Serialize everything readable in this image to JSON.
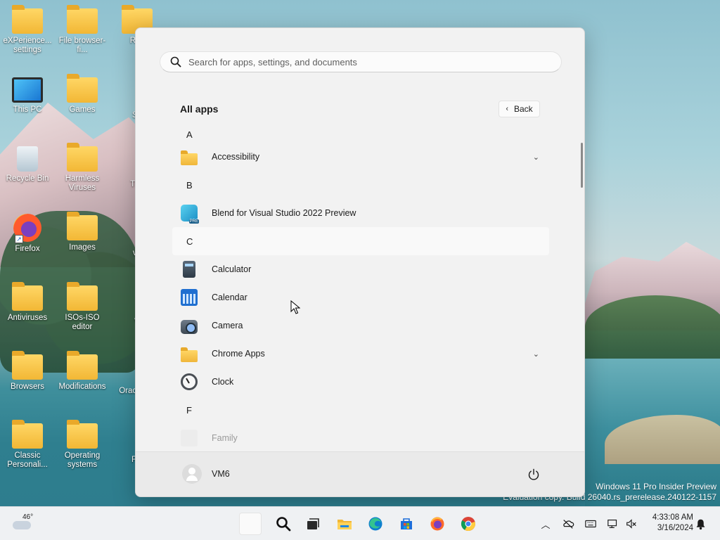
{
  "desktop": {
    "icons": [
      {
        "label": "eXPerience... settings"
      },
      {
        "label": "File browser-fi..."
      },
      {
        "label": "Rec"
      },
      {
        "label": "This PC"
      },
      {
        "label": "Games"
      },
      {
        "label": "Sp"
      },
      {
        "label": "Recycle Bin"
      },
      {
        "label": "Harmless Viruses"
      },
      {
        "label": "The"
      },
      {
        "label": "Firefox"
      },
      {
        "label": "Images"
      },
      {
        "label": "vir"
      },
      {
        "label": "Antiviruses"
      },
      {
        "label": "ISOs-ISO editor"
      },
      {
        "label": "V"
      },
      {
        "label": "Browsers"
      },
      {
        "label": "Modifications"
      },
      {
        "label": "Orac Virtu"
      },
      {
        "label": "Classic Personali..."
      },
      {
        "label": "Operating systems"
      },
      {
        "label": "Flo"
      }
    ],
    "watermark": {
      "line1": "Windows 11 Pro Insider Preview",
      "line2": "Evaluation copy. Build 26040.rs_prerelease.240122-1157"
    }
  },
  "start_menu": {
    "search_placeholder": "Search for apps, settings, and documents",
    "all_apps_title": "All apps",
    "back_label": "Back",
    "items": [
      {
        "kind": "letter",
        "text": "A"
      },
      {
        "kind": "app",
        "text": "Accessibility",
        "icon": "folder-icon",
        "expandable": true
      },
      {
        "kind": "letter",
        "text": "B"
      },
      {
        "kind": "app",
        "text": "Blend for Visual Studio 2022 Preview",
        "icon": "blend-icon"
      },
      {
        "kind": "letter",
        "text": "C"
      },
      {
        "kind": "app",
        "text": "Calculator",
        "icon": "calculator-icon"
      },
      {
        "kind": "app",
        "text": "Calendar",
        "icon": "calendar-icon"
      },
      {
        "kind": "app",
        "text": "Camera",
        "icon": "camera-icon"
      },
      {
        "kind": "app",
        "text": "Chrome Apps",
        "icon": "folder-icon",
        "expandable": true
      },
      {
        "kind": "app",
        "text": "Clock",
        "icon": "clock-icon"
      },
      {
        "kind": "letter",
        "text": "F"
      },
      {
        "kind": "app",
        "text": "Family",
        "icon": "family-icon"
      }
    ],
    "user_name": "VM6"
  },
  "taskbar": {
    "weather_temp": "46°",
    "time": "4:33:08 AM",
    "date": "3/16/2024",
    "pinned": [
      "start-icon",
      "search-icon",
      "task-view-icon",
      "file-explorer-icon",
      "edge-icon",
      "store-icon",
      "firefox-icon",
      "chrome-icon"
    ],
    "tray": [
      "chevron-up-icon",
      "onedrive-icon",
      "keyboard-icon",
      "network-icon",
      "volume-icon",
      "notification-bell-icon"
    ]
  }
}
